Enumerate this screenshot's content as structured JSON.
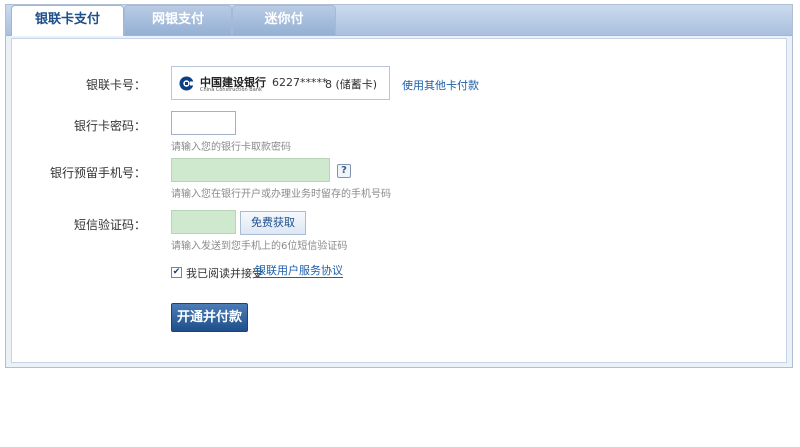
{
  "tabs": [
    {
      "label": "银联卡支付",
      "active": true
    },
    {
      "label": "网银支付",
      "active": false
    },
    {
      "label": "迷你付",
      "active": false
    }
  ],
  "card": {
    "label": "银联卡号：",
    "bank_name_cn": "中国建设银行",
    "bank_name_en": "China Construction Bank",
    "number_masked": "6227*****",
    "number_tail": "8 (储蓄卡)",
    "other_card_link": "使用其他卡付款"
  },
  "password": {
    "label": "银行卡密码：",
    "value": "",
    "hint": "请输入您的银行卡取款密码"
  },
  "phone": {
    "label": "银行预留手机号：",
    "value": "",
    "help_icon": "?",
    "hint": "请输入您在银行开户或办理业务时留存的手机号码"
  },
  "sms": {
    "label": "短信验证码：",
    "value": "",
    "button": "免费获取",
    "hint": "请输入发送到您手机上的6位短信验证码"
  },
  "agreement": {
    "checked": true,
    "text": "我已阅读并接受",
    "link": "银联用户服务协议"
  },
  "submit": {
    "label": "开通并付款"
  },
  "colors": {
    "accent": "#1d4f8c",
    "link": "#1d5fa8",
    "field_green": "#cfe9cf",
    "button": "#2a5a96"
  }
}
